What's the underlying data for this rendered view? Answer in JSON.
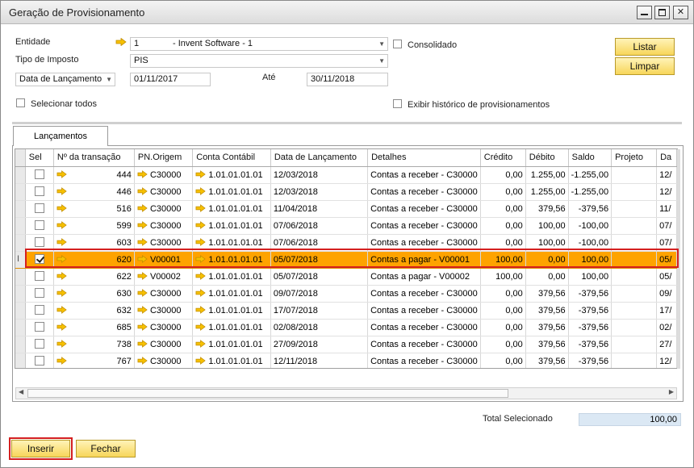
{
  "window": {
    "title": "Geração de Provisionamento"
  },
  "form": {
    "entidade_label": "Entidade",
    "entidade_code": "1",
    "entidade_name": "- Invent Software - 1",
    "tipo_imposto_label": "Tipo de Imposto",
    "tipo_imposto_value": "PIS",
    "date_filter_value": "Data de Lançamento",
    "date_from": "01/11/2017",
    "ate_label": "Até",
    "date_to": "30/11/2018",
    "consolidado_label": "Consolidado",
    "selecionar_todos_label": "Selecionar todos",
    "historico_label": "Exibir histórico de provisionamentos"
  },
  "buttons": {
    "listar": "Listar",
    "limpar": "Limpar",
    "inserir": "Inserir",
    "fechar": "Fechar"
  },
  "tabs": [
    {
      "label": "Lançamentos"
    }
  ],
  "grid": {
    "columns": [
      "Sel",
      "Nº da transação",
      "PN.Origem",
      "Conta Contábil",
      "Data de Lançamento",
      "Detalhes",
      "Crédito",
      "Débito",
      "Saldo",
      "Projeto",
      "Da"
    ],
    "rows": [
      {
        "checked": false,
        "trans": "444",
        "pn": "C30000",
        "conta": "1.01.01.01.01",
        "data": "12/03/2018",
        "detalhes": "Contas a receber - C30000",
        "credito": "0,00",
        "debito": "1.255,00",
        "saldo": "-1.255,00",
        "projeto": "",
        "da": "12/"
      },
      {
        "checked": false,
        "trans": "446",
        "pn": "C30000",
        "conta": "1.01.01.01.01",
        "data": "12/03/2018",
        "detalhes": "Contas a receber - C30000",
        "credito": "0,00",
        "debito": "1.255,00",
        "saldo": "-1.255,00",
        "projeto": "",
        "da": "12/"
      },
      {
        "checked": false,
        "trans": "516",
        "pn": "C30000",
        "conta": "1.01.01.01.01",
        "data": "11/04/2018",
        "detalhes": "Contas a receber - C30000",
        "credito": "0,00",
        "debito": "379,56",
        "saldo": "-379,56",
        "projeto": "",
        "da": "11/"
      },
      {
        "checked": false,
        "trans": "599",
        "pn": "C30000",
        "conta": "1.01.01.01.01",
        "data": "07/06/2018",
        "detalhes": "Contas a receber - C30000",
        "credito": "0,00",
        "debito": "100,00",
        "saldo": "-100,00",
        "projeto": "",
        "da": "07/"
      },
      {
        "checked": false,
        "trans": "603",
        "pn": "C30000",
        "conta": "1.01.01.01.01",
        "data": "07/06/2018",
        "detalhes": "Contas a receber - C30000",
        "credito": "0,00",
        "debito": "100,00",
        "saldo": "-100,00",
        "projeto": "",
        "da": "07/"
      },
      {
        "checked": true,
        "trans": "620",
        "pn": "V00001",
        "conta": "1.01.01.01.01",
        "data": "05/07/2018",
        "detalhes": "Contas a pagar - V00001",
        "credito": "100,00",
        "debito": "0,00",
        "saldo": "100,00",
        "projeto": "",
        "da": "05/"
      },
      {
        "checked": false,
        "trans": "622",
        "pn": "V00002",
        "conta": "1.01.01.01.01",
        "data": "05/07/2018",
        "detalhes": "Contas a pagar - V00002",
        "credito": "100,00",
        "debito": "0,00",
        "saldo": "100,00",
        "projeto": "",
        "da": "05/"
      },
      {
        "checked": false,
        "trans": "630",
        "pn": "C30000",
        "conta": "1.01.01.01.01",
        "data": "09/07/2018",
        "detalhes": "Contas a receber - C30000",
        "credito": "0,00",
        "debito": "379,56",
        "saldo": "-379,56",
        "projeto": "",
        "da": "09/"
      },
      {
        "checked": false,
        "trans": "632",
        "pn": "C30000",
        "conta": "1.01.01.01.01",
        "data": "17/07/2018",
        "detalhes": "Contas a receber - C30000",
        "credito": "0,00",
        "debito": "379,56",
        "saldo": "-379,56",
        "projeto": "",
        "da": "17/"
      },
      {
        "checked": false,
        "trans": "685",
        "pn": "C30000",
        "conta": "1.01.01.01.01",
        "data": "02/08/2018",
        "detalhes": "Contas a receber - C30000",
        "credito": "0,00",
        "debito": "379,56",
        "saldo": "-379,56",
        "projeto": "",
        "da": "02/"
      },
      {
        "checked": false,
        "trans": "738",
        "pn": "C30000",
        "conta": "1.01.01.01.01",
        "data": "27/09/2018",
        "detalhes": "Contas a receber - C30000",
        "credito": "0,00",
        "debito": "379,56",
        "saldo": "-379,56",
        "projeto": "",
        "da": "27/"
      },
      {
        "checked": false,
        "trans": "767",
        "pn": "C30000",
        "conta": "1.01.01.01.01",
        "data": "12/11/2018",
        "detalhes": "Contas a receber - C30000",
        "credito": "0,00",
        "debito": "379,56",
        "saldo": "-379,56",
        "projeto": "",
        "da": "12/"
      }
    ],
    "selected_index": 5
  },
  "total": {
    "label": "Total Selecionado",
    "value": "100,00"
  },
  "colors": {
    "accent_button": "#f7d65a",
    "selected_row": "#fea300",
    "link_arrow": "#f2b600",
    "highlight_border": "#d42020"
  },
  "icons": {
    "link_arrow": "arrow-right-icon",
    "dropdown": "chevron-down-icon"
  }
}
